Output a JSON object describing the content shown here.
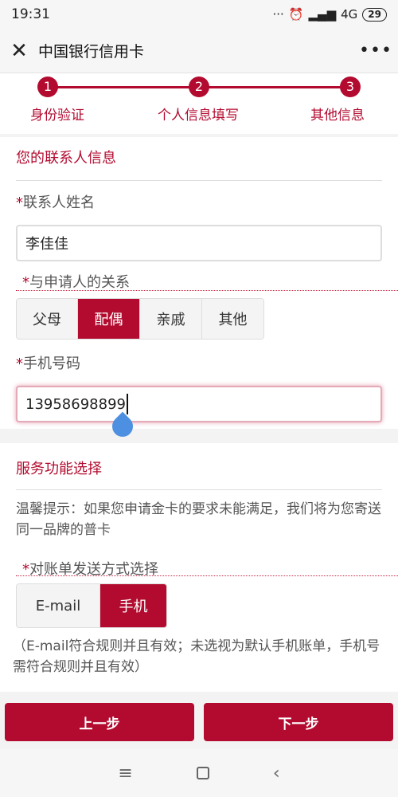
{
  "status": {
    "time": "19:31",
    "dots": "···",
    "network": "4G",
    "battery": "29"
  },
  "header": {
    "title": "中国银行信用卡"
  },
  "steps": [
    {
      "num": "1",
      "label": "身份验证"
    },
    {
      "num": "2",
      "label": "个人信息填写"
    },
    {
      "num": "3",
      "label": "其他信息"
    }
  ],
  "contact": {
    "section_title": "您的联系人信息",
    "name_label": "联系人姓名",
    "name_value": "李佳佳",
    "relation_label": "与申请人的关系",
    "relations": [
      "父母",
      "配偶",
      "亲戚",
      "其他"
    ],
    "selected_relation": "配偶",
    "phone_label": "手机号码",
    "phone_value": "13958698899"
  },
  "service": {
    "section_title": "服务功能选择",
    "tip": "温馨提示：如果您申请金卡的要求未能满足，我们将为您寄送同一品牌的普卡",
    "bill_label": "对账单发送方式选择",
    "bill_options": [
      "E-mail",
      "手机"
    ],
    "selected_bill": "手机",
    "bill_note": "（E-mail符合规则并且有效；未选视为默认手机账单，手机号需符合规则并且有效）"
  },
  "footer": {
    "prev": "上一步",
    "next": "下一步"
  },
  "required_mark": "*",
  "colors": {
    "accent": "#b30b2f",
    "background": "#f3f3f3"
  }
}
